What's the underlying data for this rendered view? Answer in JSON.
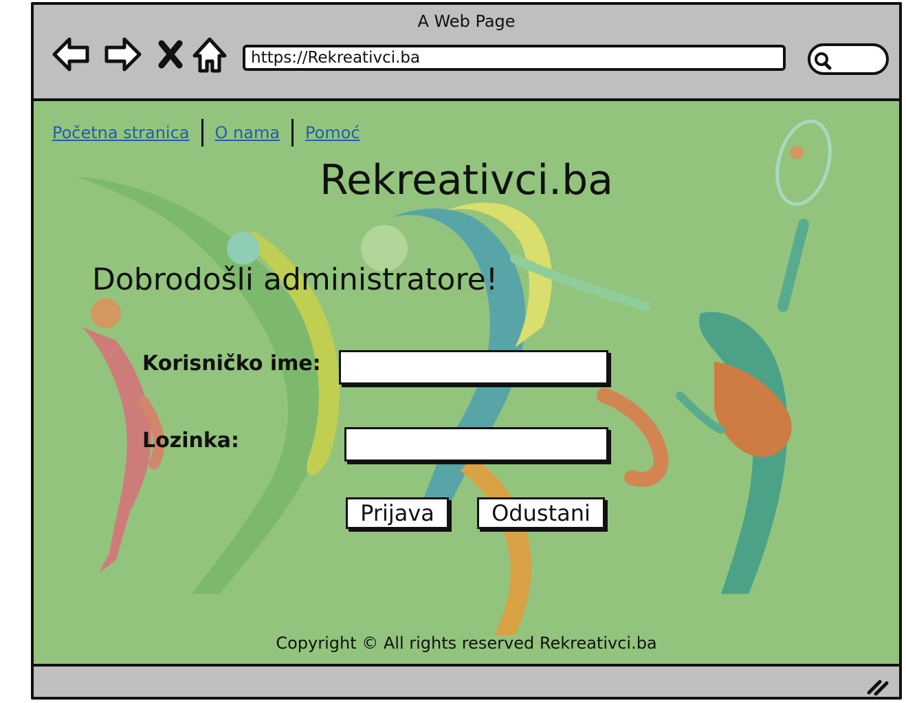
{
  "window": {
    "title": "A Web Page"
  },
  "browser": {
    "url": "https://Rekreativci.ba",
    "icons": [
      "back-arrow-icon",
      "forward-arrow-icon",
      "close-icon",
      "home-icon",
      "search-icon",
      "resize-grip-icon"
    ]
  },
  "nav": {
    "links": [
      "Početna stranica",
      "O nama",
      "Pomoć"
    ]
  },
  "page": {
    "site_title": "Rekreativci.ba",
    "welcome": "Dobrodošli administratore!",
    "username_label": "Korisničko ime:",
    "password_label": "Lozinka:",
    "username_value": "",
    "password_value": "",
    "login_button": "Prijava",
    "cancel_button": "Odustani",
    "footer": "Copyright © All rights reserved Rekreativci.ba"
  },
  "colors": {
    "content_bg": "#93c47d",
    "chrome_bg": "#bfbfbf",
    "link": "#1c5fb0"
  }
}
